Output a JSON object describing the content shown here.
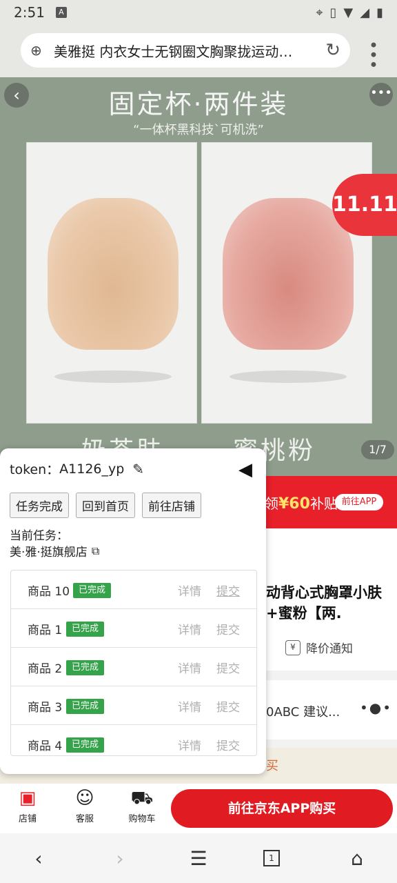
{
  "status_bar": {
    "time": "2:51",
    "notification_icon": "A"
  },
  "url_bar": {
    "page_title": "美雅挺 内衣女士无钢圈文胸聚拢运动…"
  },
  "banner": {
    "headline": "固定杯·两件装",
    "subline": "“一体杯黑科技`可机洗”",
    "color_left": "奶茶肤",
    "color_right": "蜜桃粉",
    "badge": "11.11",
    "pager": "1/7"
  },
  "promo": {
    "text_prefix": "领",
    "amount": "¥60",
    "text_suffix": "补贴",
    "app_button": "前往APP"
  },
  "product": {
    "name": "动背心式胸罩小肤+蜜粉【两.",
    "price_notify": "降价通知"
  },
  "recommend": {
    "text": "0ABC 建议...",
    "more": "•●•"
  },
  "hint": {
    "text": "买"
  },
  "action_bar": {
    "shop_label": "店铺",
    "service_label": "客服",
    "cart_label": "购物车",
    "buy_button": "前往京东APP购买"
  },
  "task_panel": {
    "token_label": "token：",
    "token_value": "A1126_yp",
    "buttons": [
      "任务完成",
      "回到首页",
      "前往店铺"
    ],
    "current_task_label": "当前任务：",
    "store_name": "美·雅·挺旗舰店",
    "tasks": [
      {
        "name": "商品 10",
        "status": "已完成",
        "detail": "详情",
        "submit": "提交"
      },
      {
        "name": "商品 1",
        "status": "已完成",
        "detail": "详情",
        "submit": "提交"
      },
      {
        "name": "商品 2",
        "status": "已完成",
        "detail": "详情",
        "submit": "提交"
      },
      {
        "name": "商品 3",
        "status": "已完成",
        "detail": "详情",
        "submit": "提交"
      },
      {
        "name": "商品 4",
        "status": "已完成",
        "detail": "详情",
        "submit": "提交"
      }
    ]
  },
  "colors": {
    "brand_red": "#e01c22",
    "done_green": "#35a34a",
    "banner_bg": "#8f9d8d"
  }
}
